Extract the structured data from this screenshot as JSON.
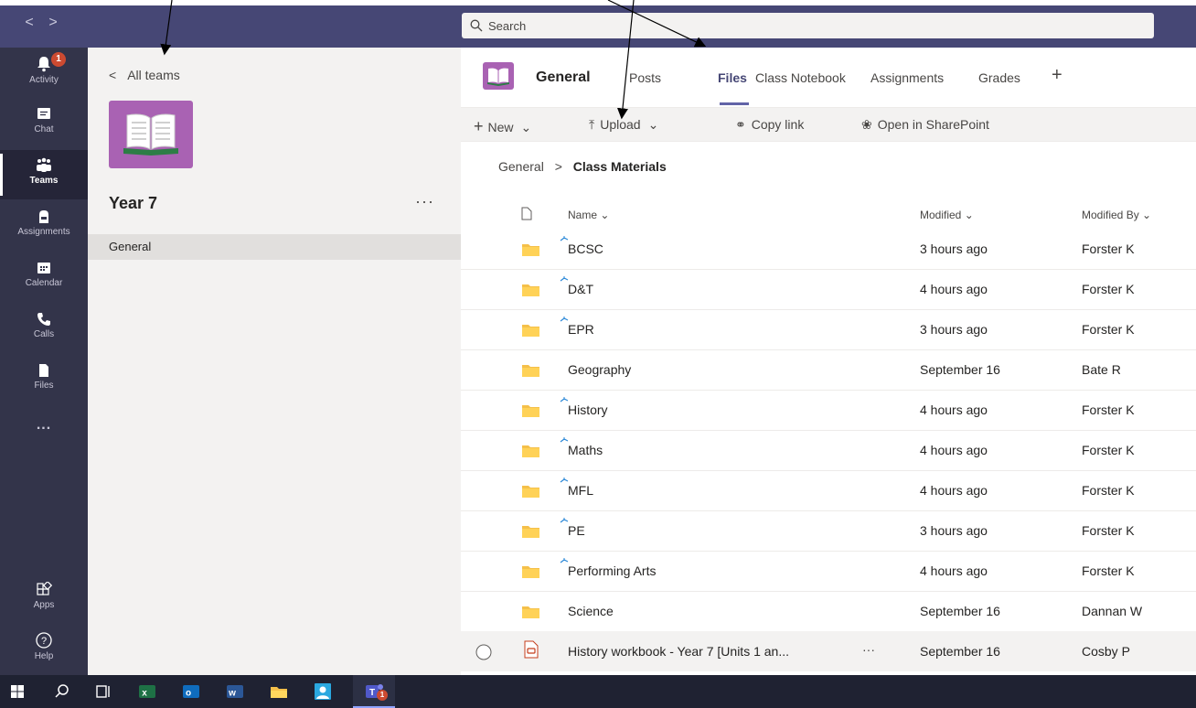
{
  "search": {
    "placeholder": "Search"
  },
  "nav": {
    "back": "<",
    "forward": ">"
  },
  "app_bar": {
    "activity_badge": "1",
    "items": [
      {
        "label": "Activity"
      },
      {
        "label": "Chat"
      },
      {
        "label": "Teams"
      },
      {
        "label": "Assignments"
      },
      {
        "label": "Calendar"
      },
      {
        "label": "Calls"
      },
      {
        "label": "Files"
      },
      {
        "label": "..."
      },
      {
        "label": "Apps"
      },
      {
        "label": "Help"
      }
    ]
  },
  "team_panel": {
    "back_label": "All teams",
    "team_name": "Year 7",
    "more": "···",
    "channels": [
      {
        "label": "General"
      }
    ]
  },
  "channel": {
    "title": "General",
    "tabs": [
      {
        "label": "Posts"
      },
      {
        "label": "Files"
      },
      {
        "label": "Class Notebook"
      },
      {
        "label": "Assignments"
      },
      {
        "label": "Grades"
      }
    ],
    "add_tab": "+"
  },
  "toolbar": {
    "new_label": "New",
    "upload_label": "Upload",
    "copy_link_label": "Copy link",
    "sharepoint_label": "Open in SharePoint"
  },
  "breadcrumb": {
    "root": "General",
    "separator": ">",
    "current": "Class Materials"
  },
  "file_list": {
    "columns": {
      "name": "Name",
      "modified": "Modified",
      "modified_by": "Modified By"
    },
    "rows": [
      {
        "name": "BCSC",
        "modified": "3 hours ago",
        "modified_by": "Forster K",
        "sync": true
      },
      {
        "name": "D&T",
        "modified": "4 hours ago",
        "modified_by": "Forster K",
        "sync": true
      },
      {
        "name": "EPR",
        "modified": "3 hours ago",
        "modified_by": "Forster K",
        "sync": true
      },
      {
        "name": "Geography",
        "modified": "September 16",
        "modified_by": "Bate R",
        "sync": false
      },
      {
        "name": "History",
        "modified": "4 hours ago",
        "modified_by": "Forster K",
        "sync": true
      },
      {
        "name": "Maths",
        "modified": "4 hours ago",
        "modified_by": "Forster K",
        "sync": true
      },
      {
        "name": "MFL",
        "modified": "4 hours ago",
        "modified_by": "Forster K",
        "sync": true
      },
      {
        "name": "PE",
        "modified": "3 hours ago",
        "modified_by": "Forster K",
        "sync": true
      },
      {
        "name": "Performing Arts",
        "modified": "4 hours ago",
        "modified_by": "Forster K",
        "sync": true
      },
      {
        "name": "Science",
        "modified": "September 16",
        "modified_by": "Dannan W",
        "sync": false
      }
    ],
    "file_row": {
      "name": "History workbook - Year 7 [Units 1 an...",
      "more": "···",
      "modified": "September 16",
      "modified_by": "Cosby P"
    }
  },
  "taskbar": {
    "teams_badge": "1"
  },
  "colors": {
    "titlebar": "#464775",
    "appbar": "#33344a",
    "accent": "#6264a7",
    "team_tile": "#a962b3",
    "folder": "#f5c04a"
  }
}
